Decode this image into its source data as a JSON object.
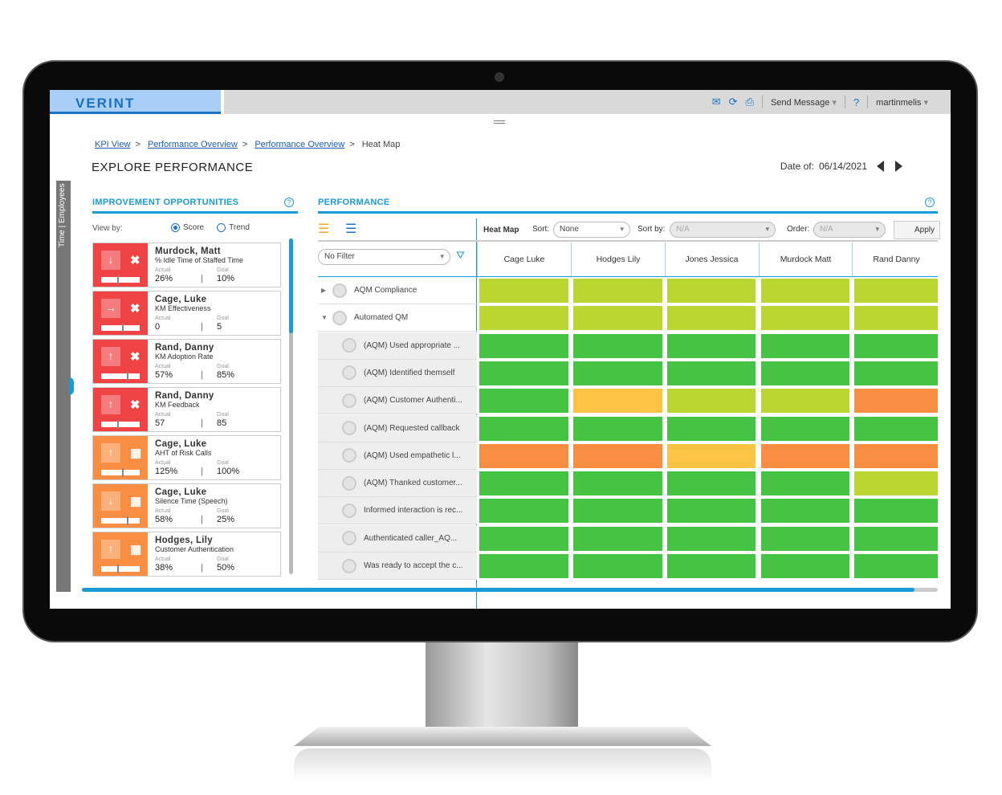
{
  "app": {
    "logo": "VERINT",
    "send_message": "Send Message",
    "help": "?",
    "user": "martinmelis",
    "icons": [
      "email-icon",
      "refresh-icon",
      "print-icon"
    ]
  },
  "breadcrumb": [
    "KPI View",
    "Performance Overview",
    "Performance Overview",
    "Heat Map"
  ],
  "page_title": "EXPLORE PERFORMANCE",
  "date": {
    "label": "Date of:",
    "value": "06/14/2021"
  },
  "side_tab": "Time | Employees",
  "improvement": {
    "title": "IMPROVEMENT OPPORTUNITIES",
    "view_by": "View by:",
    "options": [
      "Score",
      "Trend"
    ],
    "selected": "Score",
    "actual_label": "Actual",
    "goal_label": "Goal",
    "cards": [
      {
        "name": "Murdock, Matt",
        "metric": "% Idle Time of Staffed Time",
        "actual": "26%",
        "goal": "10%",
        "status": "red",
        "trend": "down"
      },
      {
        "name": "Cage, Luke",
        "metric": "KM Effectiveness",
        "actual": "0",
        "goal": "5",
        "status": "red",
        "trend": "flat"
      },
      {
        "name": "Rand, Danny",
        "metric": "KM Adoption Rate",
        "actual": "57%",
        "goal": "85%",
        "status": "red",
        "trend": "up"
      },
      {
        "name": "Rand, Danny",
        "metric": "KM Feedback",
        "actual": "57",
        "goal": "85",
        "status": "red",
        "trend": "up"
      },
      {
        "name": "Cage, Luke",
        "metric": "AHT of Risk Calls",
        "actual": "125%",
        "goal": "100%",
        "status": "orange",
        "trend": "up"
      },
      {
        "name": "Cage, Luke",
        "metric": "Silence Time (Speech)",
        "actual": "58%",
        "goal": "25%",
        "status": "orange",
        "trend": "down"
      },
      {
        "name": "Hodges, Lily",
        "metric": "Customer Authentication",
        "actual": "38%",
        "goal": "50%",
        "status": "orange",
        "trend": "up"
      }
    ]
  },
  "performance": {
    "title": "PERFORMANCE",
    "heat_map_label": "Heat Map",
    "sort_label": "Sort:",
    "sort_value": "None",
    "sort_by_label": "Sort by:",
    "sort_by_value": "N/A",
    "order_label": "Order:",
    "order_value": "N/A",
    "apply": "Apply",
    "filter": "No Filter",
    "columns": [
      "Cage Luke",
      "Hodges Lily",
      "Jones Jessica",
      "Murdock Matt",
      "Rand Danny"
    ],
    "rows": [
      {
        "label": "AQM Compliance",
        "level": 0,
        "expanded": false,
        "cells": [
          "lime",
          "lime",
          "lime",
          "lime",
          "lime"
        ]
      },
      {
        "label": "Automated QM",
        "level": 0,
        "expanded": true,
        "cells": [
          "lime",
          "lime",
          "lime",
          "lime",
          "lime"
        ]
      },
      {
        "label": "(AQM) Used appropriate ...",
        "level": 1,
        "cells": [
          "green",
          "green",
          "green",
          "green",
          "green"
        ]
      },
      {
        "label": "(AQM) Identified themself",
        "level": 1,
        "cells": [
          "green",
          "green",
          "green",
          "green",
          "green"
        ]
      },
      {
        "label": "(AQM) Customer Authenti...",
        "level": 1,
        "cells": [
          "green",
          "yellow",
          "lime",
          "lime",
          "orange"
        ]
      },
      {
        "label": "(AQM) Requested callback",
        "level": 1,
        "cells": [
          "green",
          "green",
          "green",
          "green",
          "green"
        ]
      },
      {
        "label": "(AQM) Used empathetic l...",
        "level": 1,
        "cells": [
          "orange",
          "orange",
          "yellow",
          "orange",
          "orange"
        ]
      },
      {
        "label": "(AQM) Thanked customer...",
        "level": 1,
        "cells": [
          "green",
          "green",
          "green",
          "green",
          "lime"
        ]
      },
      {
        "label": "Informed interaction is rec...",
        "level": 1,
        "cells": [
          "green",
          "green",
          "green",
          "green",
          "green"
        ]
      },
      {
        "label": "Authenticated caller_AQ...",
        "level": 1,
        "cells": [
          "green",
          "green",
          "green",
          "green",
          "green"
        ]
      },
      {
        "label": "Was ready to accept the c...",
        "level": 1,
        "cells": [
          "green",
          "green",
          "green",
          "green",
          "green"
        ]
      }
    ]
  },
  "colors": {
    "red": "#f04444",
    "orange": "#f98d42",
    "lime": "#bcd631",
    "green": "#45c443",
    "yellow": "#fdc342",
    "accent": "#1a9ad6"
  }
}
